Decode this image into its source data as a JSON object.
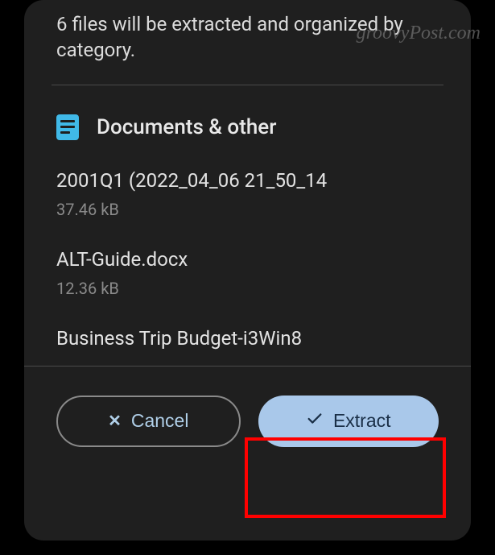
{
  "header": {
    "message": "6 files will be extracted and organized by category."
  },
  "section": {
    "title": "Documents & other"
  },
  "files": [
    {
      "name": "2001Q1 (2022_04_06 21_50_14",
      "size": "37.46 kB"
    },
    {
      "name": "ALT-Guide.docx",
      "size": "12.36 kB"
    },
    {
      "name": "Business Trip Budget-i3Win8",
      "size": ""
    }
  ],
  "buttons": {
    "cancel": "Cancel",
    "extract": "Extract"
  },
  "watermark": "groovyPost.com"
}
